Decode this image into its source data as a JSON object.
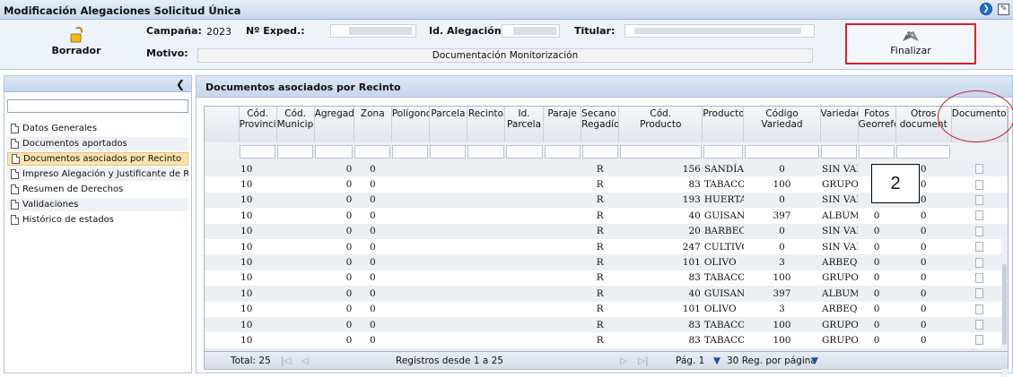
{
  "window": {
    "title": "Modificación Alegaciones Solicitud Única"
  },
  "toolbar": {
    "borrador_label": "Borrador",
    "campana_label": "Campaña:",
    "campana_value": "2023",
    "exped_label": "Nº Exped.:",
    "id_alegacion_label": "Id. Alegación:",
    "titular_label": "Titular:",
    "motivo_label": "Motivo:",
    "motivo_value": "Documentación Monitorización",
    "finalizar_label": "Finalizar"
  },
  "sidebar": {
    "items": [
      {
        "label": "Datos Generales"
      },
      {
        "label": "Documentos aportados"
      },
      {
        "label": "Documentos asociados por Recinto"
      },
      {
        "label": "Impreso Alegación y Justificante de Re"
      },
      {
        "label": "Resumen de Derechos"
      },
      {
        "label": "Validaciones"
      },
      {
        "label": "Histórico de estados"
      }
    ]
  },
  "main": {
    "title": "Documentos asociados por Recinto"
  },
  "table": {
    "columns": [
      "Cód. Provincia",
      "Cód. Municipio",
      "Agregado",
      "Zona",
      "Polígono",
      "Parcela",
      "Recinto",
      "Id. Parcela",
      "Paraje",
      "Secano / Regadío",
      "Cód. Producto",
      "Producto",
      "Código Variedad",
      "Variedad",
      "Fotos Georreferenciadas",
      "Otros documentos",
      "Documentos"
    ],
    "column_display": [
      [
        "Cód.",
        "Provincia"
      ],
      [
        "Cód.",
        "Municipio"
      ],
      [
        "Agregado",
        ""
      ],
      [
        "Zona",
        ""
      ],
      [
        "Polígono",
        ""
      ],
      [
        "Parcela",
        ""
      ],
      [
        "Recinto",
        ""
      ],
      [
        "Id.",
        "Parcela"
      ],
      [
        "Paraje",
        ""
      ],
      [
        "Secano /",
        "Regadío"
      ],
      [
        "Cód.",
        "Producto"
      ],
      [
        "Producto",
        ""
      ],
      [
        "Código",
        "Variedad"
      ],
      [
        "Variedad",
        ""
      ],
      [
        "Fotos",
        "Georrefer"
      ],
      [
        "Otros",
        "document"
      ],
      [
        "Documentos",
        ""
      ]
    ],
    "rows": [
      [
        "10",
        "0",
        "0",
        "R",
        "156",
        "SANDÍA",
        "0",
        "SIN VARIEDAD",
        "0",
        "0"
      ],
      [
        "10",
        "0",
        "0",
        "R",
        "83",
        "TABACO",
        "100",
        "GRUPO I. VIRGINI",
        "0",
        "0"
      ],
      [
        "10",
        "0",
        "0",
        "R",
        "193",
        "HUERTA",
        "0",
        "SIN VARIEDAD",
        "0",
        "0"
      ],
      [
        "10",
        "0",
        "0",
        "R",
        "40",
        "GUISANTE",
        "397",
        "ALBUM",
        "0",
        "0"
      ],
      [
        "10",
        "0",
        "0",
        "R",
        "20",
        "BARBECHO TRADICIONA",
        "0",
        "SIN VARIEDAD",
        "0",
        "0"
      ],
      [
        "10",
        "0",
        "0",
        "R",
        "247",
        "CULTIVOS MIXTOS DE E",
        "0",
        "SIN VARIEDAD",
        "0",
        "0"
      ],
      [
        "10",
        "0",
        "0",
        "R",
        "101",
        "OLIVO",
        "3",
        "ARBEQUINA",
        "0",
        "0"
      ],
      [
        "10",
        "0",
        "0",
        "R",
        "83",
        "TABACO",
        "100",
        "GRUPO I. VIRGINI",
        "0",
        "0"
      ],
      [
        "10",
        "0",
        "0",
        "R",
        "40",
        "GUISANTE",
        "397",
        "ALBUM",
        "0",
        "0"
      ],
      [
        "10",
        "0",
        "0",
        "R",
        "101",
        "OLIVO",
        "3",
        "ARBEQUINA",
        "0",
        "0"
      ],
      [
        "10",
        "0",
        "0",
        "R",
        "83",
        "TABACO",
        "100",
        "GRUPO I. VIRGINI",
        "0",
        "0"
      ],
      [
        "10",
        "0",
        "0",
        "R",
        "83",
        "TABACO",
        "100",
        "GRUPO I. VIRGINI",
        "0",
        "0"
      ]
    ]
  },
  "pager": {
    "total": "Total: 25",
    "registros": "Registros desde 1 a 25",
    "pagina": "Pág. 1",
    "per_page": "30 Reg. por página"
  },
  "annotation": {
    "number": "2"
  }
}
